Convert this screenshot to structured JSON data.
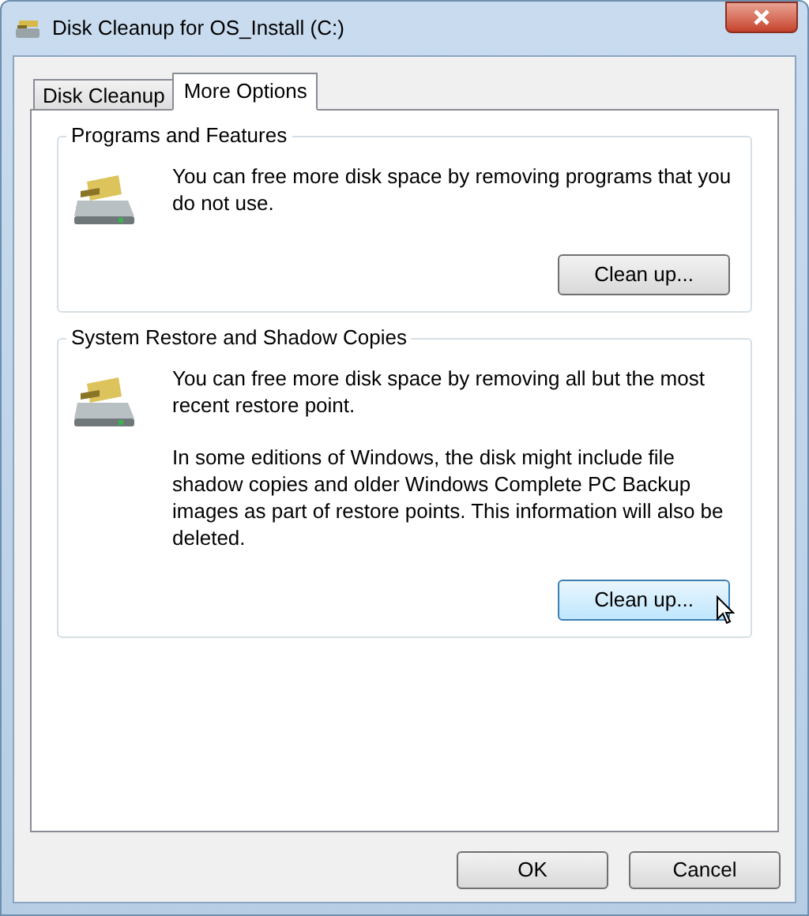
{
  "window": {
    "title": "Disk Cleanup for OS_Install (C:)"
  },
  "tabs": [
    {
      "label": "Disk Cleanup",
      "selected": false
    },
    {
      "label": "More Options",
      "selected": true
    }
  ],
  "groups": [
    {
      "title": "Programs and Features",
      "paragraphs": [
        "You can free more disk space by removing programs that you do not use."
      ],
      "button": {
        "label": "Clean up...",
        "hovered": false
      }
    },
    {
      "title": "System Restore and Shadow Copies",
      "paragraphs": [
        "You can free more disk space by removing all but the most recent restore point.",
        "In some editions of Windows, the disk might include file shadow copies and older Windows Complete PC Backup images as part of restore points. This information will also be deleted."
      ],
      "button": {
        "label": "Clean up...",
        "hovered": true
      }
    }
  ],
  "buttons": [
    "OK",
    "Cancel"
  ]
}
